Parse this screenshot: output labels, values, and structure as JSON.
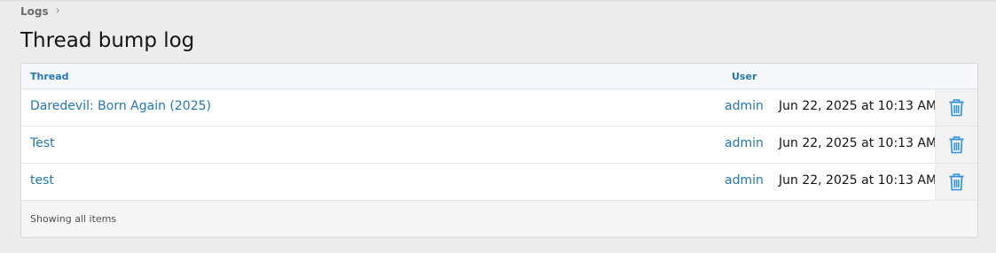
{
  "breadcrumb": {
    "label": "Logs",
    "chevron": "›"
  },
  "page": {
    "title": "Thread bump log"
  },
  "table": {
    "headers": {
      "thread": "Thread",
      "user": "User"
    },
    "rows": [
      {
        "thread": "Daredevil: Born Again (2025)",
        "user": "admin",
        "date": "Jun 22, 2025 at 10:13 AM"
      },
      {
        "thread": "Test",
        "user": "admin",
        "date": "Jun 22, 2025 at 10:13 AM"
      },
      {
        "thread": "test",
        "user": "admin",
        "date": "Jun 22, 2025 at 10:13 AM"
      }
    ],
    "delete_icon": "trash-icon",
    "footer": "Showing all items"
  },
  "colors": {
    "link": "#2577b1",
    "background": "#ececec",
    "header_bg": "#f5f8fc"
  }
}
